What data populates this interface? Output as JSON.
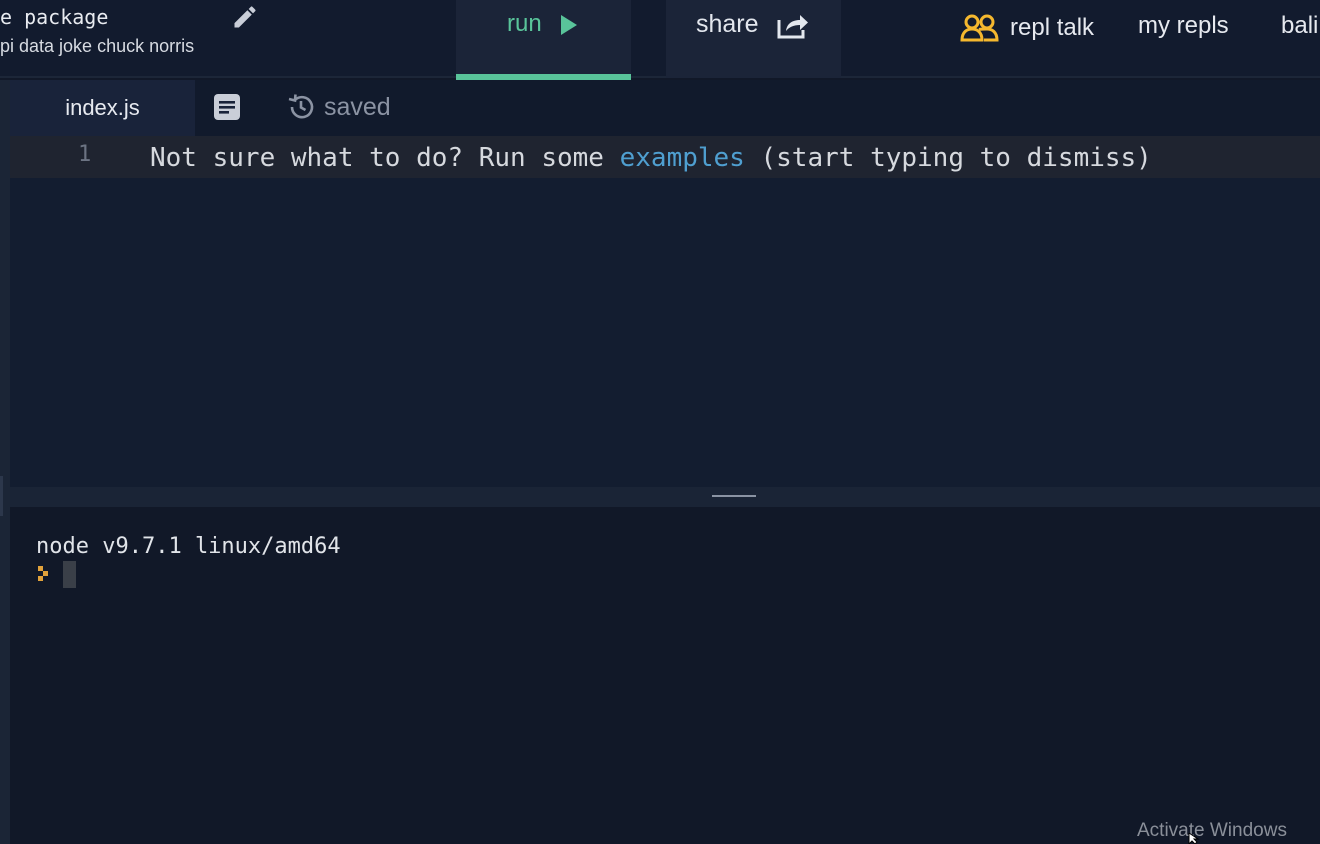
{
  "header": {
    "repl_title": "e package",
    "repl_description": "pi data joke chuck norris",
    "run_label": "run",
    "share_label": "share",
    "nav": {
      "repl_talk": "repl talk",
      "my_repls": "my repls",
      "user": "bali"
    }
  },
  "editor": {
    "tab_filename": "index.js",
    "save_status": "saved",
    "line_number": "1",
    "hint_before": "Not sure what to do? Run some ",
    "hint_link": "examples",
    "hint_after": " (start typing to dismiss)"
  },
  "console": {
    "version_line": "node v9.7.1 linux/amd64"
  },
  "overlay": {
    "watermark": "Activate Windows"
  },
  "colors": {
    "accent_green": "#59c49a",
    "link_blue": "#4f9fd0",
    "talk_icon_yellow": "#f5b82e",
    "prompt_orange": "#e2a23b"
  },
  "icons": {
    "edit": "pencil-icon",
    "run": "play-icon",
    "share": "share-icon",
    "talk": "users-icon",
    "files": "document-icon",
    "saved": "history-icon",
    "prompt": "prompt-arrow-icon"
  }
}
